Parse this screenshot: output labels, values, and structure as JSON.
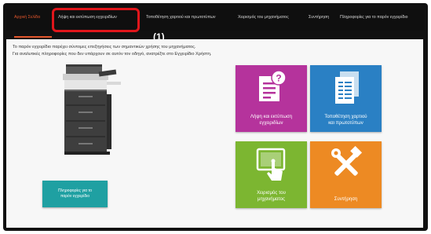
{
  "nav": {
    "home": "Αρχική Σελίδα",
    "manuals": "Λήψη και εκτύπωση εγχειριδίων",
    "paper": "Τοποθέτηση χαρτιού και πρωτοτύπων",
    "machine": "Χειρισμός του μηχανήματος",
    "maintenance": "Συντήρηση",
    "about": "Πληροφορίες για το παρόν εγχειρίδιο"
  },
  "callout": "(1)",
  "intro": {
    "line1": "Το παρόν εγχειρίδιο παρέχει σύντομες επεξηγήσεις των σημαντικών χρήσης του μηχανήματος.",
    "line2": "Για αναλυτικές πληροφορίες που δεν υπάρχουν σε αυτόν τον οδηγό, ανατρέξτε στο Εγχειρίδιο Χρήστη."
  },
  "manual_button": {
    "line1": "Πληροφορίες για το",
    "line2": "παρόν εγχειρίδιο"
  },
  "tiles": [
    {
      "line1": "Λήψη και εκτύπωση",
      "line2": "εγχειριδίων",
      "color": "#b5339c",
      "icon": "download-manual-icon"
    },
    {
      "line1": "Τοποθέτηση χαρτιού",
      "line2": "και πρωτοτύπων",
      "color": "#2a80c4",
      "icon": "paper-stack-icon"
    },
    {
      "line1": "Χειρισμός του",
      "line2": "μηχανήματος",
      "color": "#7cb631",
      "icon": "touch-panel-icon"
    },
    {
      "line1": "Συντήρηση",
      "line2": "",
      "color": "#ed8a23",
      "icon": "tools-icon"
    }
  ],
  "colors": {
    "accent": "#e2562c",
    "highlight_border": "#e0161b",
    "teal_button": "#1fa0a2"
  }
}
